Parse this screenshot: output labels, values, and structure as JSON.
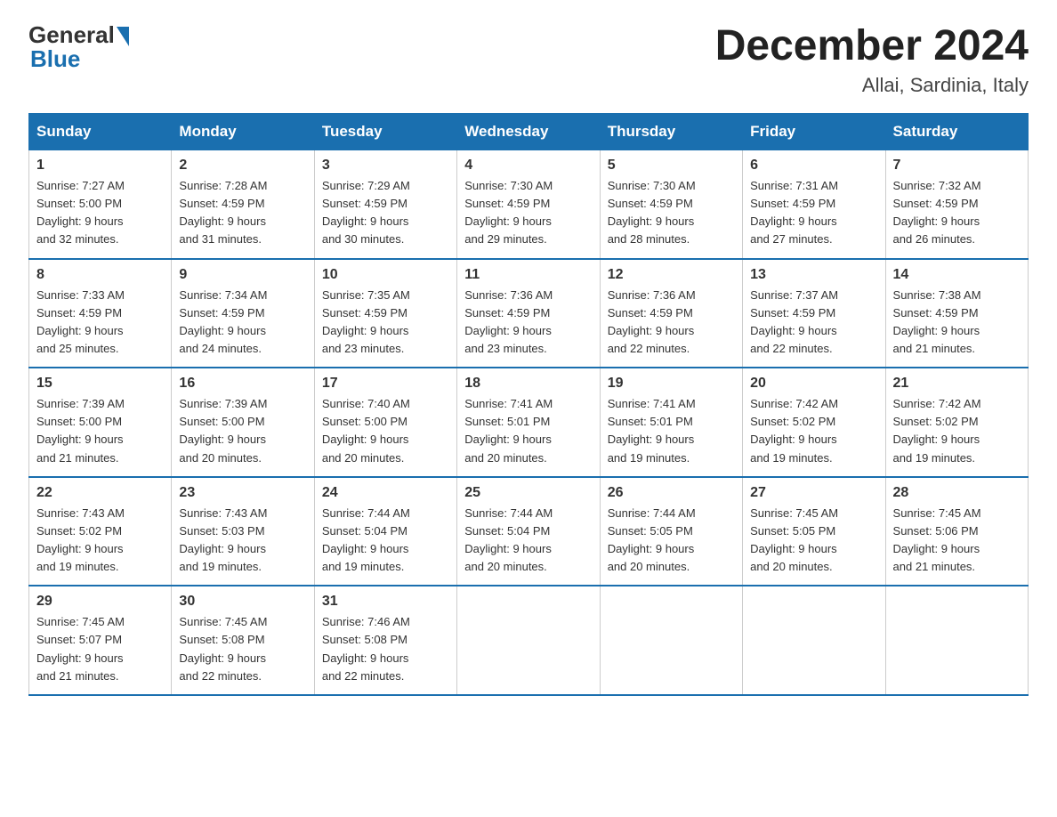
{
  "logo": {
    "general": "General",
    "blue": "Blue"
  },
  "title": "December 2024",
  "location": "Allai, Sardinia, Italy",
  "days_of_week": [
    "Sunday",
    "Monday",
    "Tuesday",
    "Wednesday",
    "Thursday",
    "Friday",
    "Saturday"
  ],
  "weeks": [
    [
      {
        "day": "1",
        "sunrise": "7:27 AM",
        "sunset": "5:00 PM",
        "daylight": "9 hours and 32 minutes."
      },
      {
        "day": "2",
        "sunrise": "7:28 AM",
        "sunset": "4:59 PM",
        "daylight": "9 hours and 31 minutes."
      },
      {
        "day": "3",
        "sunrise": "7:29 AM",
        "sunset": "4:59 PM",
        "daylight": "9 hours and 30 minutes."
      },
      {
        "day": "4",
        "sunrise": "7:30 AM",
        "sunset": "4:59 PM",
        "daylight": "9 hours and 29 minutes."
      },
      {
        "day": "5",
        "sunrise": "7:30 AM",
        "sunset": "4:59 PM",
        "daylight": "9 hours and 28 minutes."
      },
      {
        "day": "6",
        "sunrise": "7:31 AM",
        "sunset": "4:59 PM",
        "daylight": "9 hours and 27 minutes."
      },
      {
        "day": "7",
        "sunrise": "7:32 AM",
        "sunset": "4:59 PM",
        "daylight": "9 hours and 26 minutes."
      }
    ],
    [
      {
        "day": "8",
        "sunrise": "7:33 AM",
        "sunset": "4:59 PM",
        "daylight": "9 hours and 25 minutes."
      },
      {
        "day": "9",
        "sunrise": "7:34 AM",
        "sunset": "4:59 PM",
        "daylight": "9 hours and 24 minutes."
      },
      {
        "day": "10",
        "sunrise": "7:35 AM",
        "sunset": "4:59 PM",
        "daylight": "9 hours and 23 minutes."
      },
      {
        "day": "11",
        "sunrise": "7:36 AM",
        "sunset": "4:59 PM",
        "daylight": "9 hours and 23 minutes."
      },
      {
        "day": "12",
        "sunrise": "7:36 AM",
        "sunset": "4:59 PM",
        "daylight": "9 hours and 22 minutes."
      },
      {
        "day": "13",
        "sunrise": "7:37 AM",
        "sunset": "4:59 PM",
        "daylight": "9 hours and 22 minutes."
      },
      {
        "day": "14",
        "sunrise": "7:38 AM",
        "sunset": "4:59 PM",
        "daylight": "9 hours and 21 minutes."
      }
    ],
    [
      {
        "day": "15",
        "sunrise": "7:39 AM",
        "sunset": "5:00 PM",
        "daylight": "9 hours and 21 minutes."
      },
      {
        "day": "16",
        "sunrise": "7:39 AM",
        "sunset": "5:00 PM",
        "daylight": "9 hours and 20 minutes."
      },
      {
        "day": "17",
        "sunrise": "7:40 AM",
        "sunset": "5:00 PM",
        "daylight": "9 hours and 20 minutes."
      },
      {
        "day": "18",
        "sunrise": "7:41 AM",
        "sunset": "5:01 PM",
        "daylight": "9 hours and 20 minutes."
      },
      {
        "day": "19",
        "sunrise": "7:41 AM",
        "sunset": "5:01 PM",
        "daylight": "9 hours and 19 minutes."
      },
      {
        "day": "20",
        "sunrise": "7:42 AM",
        "sunset": "5:02 PM",
        "daylight": "9 hours and 19 minutes."
      },
      {
        "day": "21",
        "sunrise": "7:42 AM",
        "sunset": "5:02 PM",
        "daylight": "9 hours and 19 minutes."
      }
    ],
    [
      {
        "day": "22",
        "sunrise": "7:43 AM",
        "sunset": "5:02 PM",
        "daylight": "9 hours and 19 minutes."
      },
      {
        "day": "23",
        "sunrise": "7:43 AM",
        "sunset": "5:03 PM",
        "daylight": "9 hours and 19 minutes."
      },
      {
        "day": "24",
        "sunrise": "7:44 AM",
        "sunset": "5:04 PM",
        "daylight": "9 hours and 19 minutes."
      },
      {
        "day": "25",
        "sunrise": "7:44 AM",
        "sunset": "5:04 PM",
        "daylight": "9 hours and 20 minutes."
      },
      {
        "day": "26",
        "sunrise": "7:44 AM",
        "sunset": "5:05 PM",
        "daylight": "9 hours and 20 minutes."
      },
      {
        "day": "27",
        "sunrise": "7:45 AM",
        "sunset": "5:05 PM",
        "daylight": "9 hours and 20 minutes."
      },
      {
        "day": "28",
        "sunrise": "7:45 AM",
        "sunset": "5:06 PM",
        "daylight": "9 hours and 21 minutes."
      }
    ],
    [
      {
        "day": "29",
        "sunrise": "7:45 AM",
        "sunset": "5:07 PM",
        "daylight": "9 hours and 21 minutes."
      },
      {
        "day": "30",
        "sunrise": "7:45 AM",
        "sunset": "5:08 PM",
        "daylight": "9 hours and 22 minutes."
      },
      {
        "day": "31",
        "sunrise": "7:46 AM",
        "sunset": "5:08 PM",
        "daylight": "9 hours and 22 minutes."
      },
      null,
      null,
      null,
      null
    ]
  ],
  "labels": {
    "sunrise": "Sunrise:",
    "sunset": "Sunset:",
    "daylight": "Daylight:"
  }
}
